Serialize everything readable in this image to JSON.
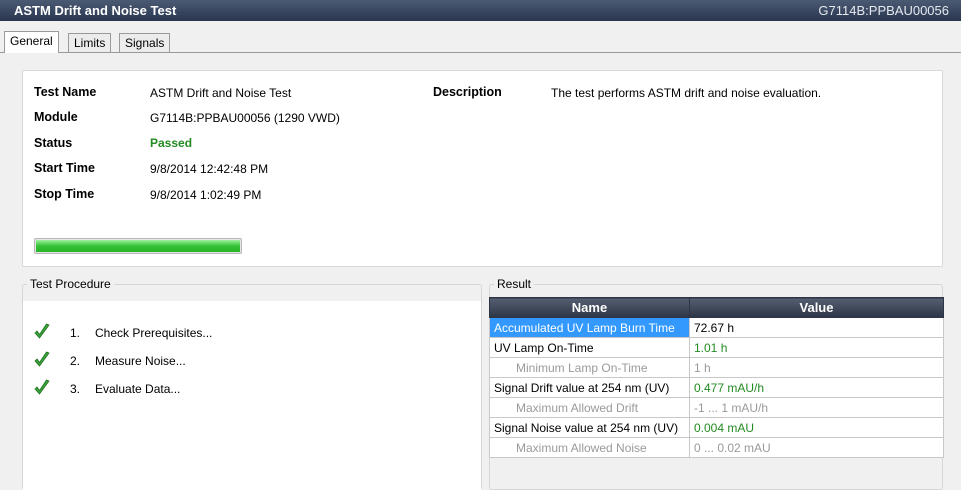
{
  "window": {
    "title": "ASTM Drift and Noise Test",
    "instrument_id": "G7114B:PPBAU00056"
  },
  "tabs": [
    {
      "label": "General",
      "active": true
    },
    {
      "label": "Limits",
      "active": false
    },
    {
      "label": "Signals",
      "active": false
    }
  ],
  "info": {
    "test_name_label": "Test Name",
    "test_name": "ASTM Drift and Noise Test",
    "module_label": "Module",
    "module": "G7114B:PPBAU00056 (1290 VWD)",
    "status_label": "Status",
    "status": "Passed",
    "start_time_label": "Start Time",
    "start_time": "9/8/2014 12:42:48 PM",
    "stop_time_label": "Stop Time",
    "stop_time": "9/8/2014 1:02:49 PM",
    "description_label": "Description",
    "description": "The test performs ASTM drift and noise evaluation.",
    "progress_fraction": 1.0
  },
  "procedure": {
    "title": "Test Procedure",
    "steps": [
      {
        "num": "1.",
        "label": "Check Prerequisites...",
        "icon": "check-icon"
      },
      {
        "num": "2.",
        "label": "Measure Noise...",
        "icon": "check-icon"
      },
      {
        "num": "3.",
        "label": "Evaluate Data...",
        "icon": "check-icon"
      }
    ]
  },
  "result": {
    "title": "Result",
    "col_name": "Name",
    "col_value": "Value",
    "rows": [
      {
        "name": "Accumulated UV Lamp Burn Time",
        "value": "72.67 h"
      },
      {
        "name": "UV Lamp On-Time",
        "value": "1.01 h"
      },
      {
        "name": "Minimum Lamp On-Time",
        "value": "1 h"
      },
      {
        "name": "Signal Drift value at 254 nm (UV)",
        "value": "0.477 mAU/h"
      },
      {
        "name": "Maximum Allowed Drift",
        "value": "-1 ... 1 mAU/h"
      },
      {
        "name": "Signal Noise value at 254 nm (UV)",
        "value": "0.004 mAU"
      },
      {
        "name": "Maximum Allowed Noise",
        "value": "0 ... 0.02 mAU"
      }
    ]
  },
  "colors": {
    "passed": "#228b22",
    "selection": "#3399ff",
    "header": "#2d3546",
    "check": "#3aa53a"
  }
}
